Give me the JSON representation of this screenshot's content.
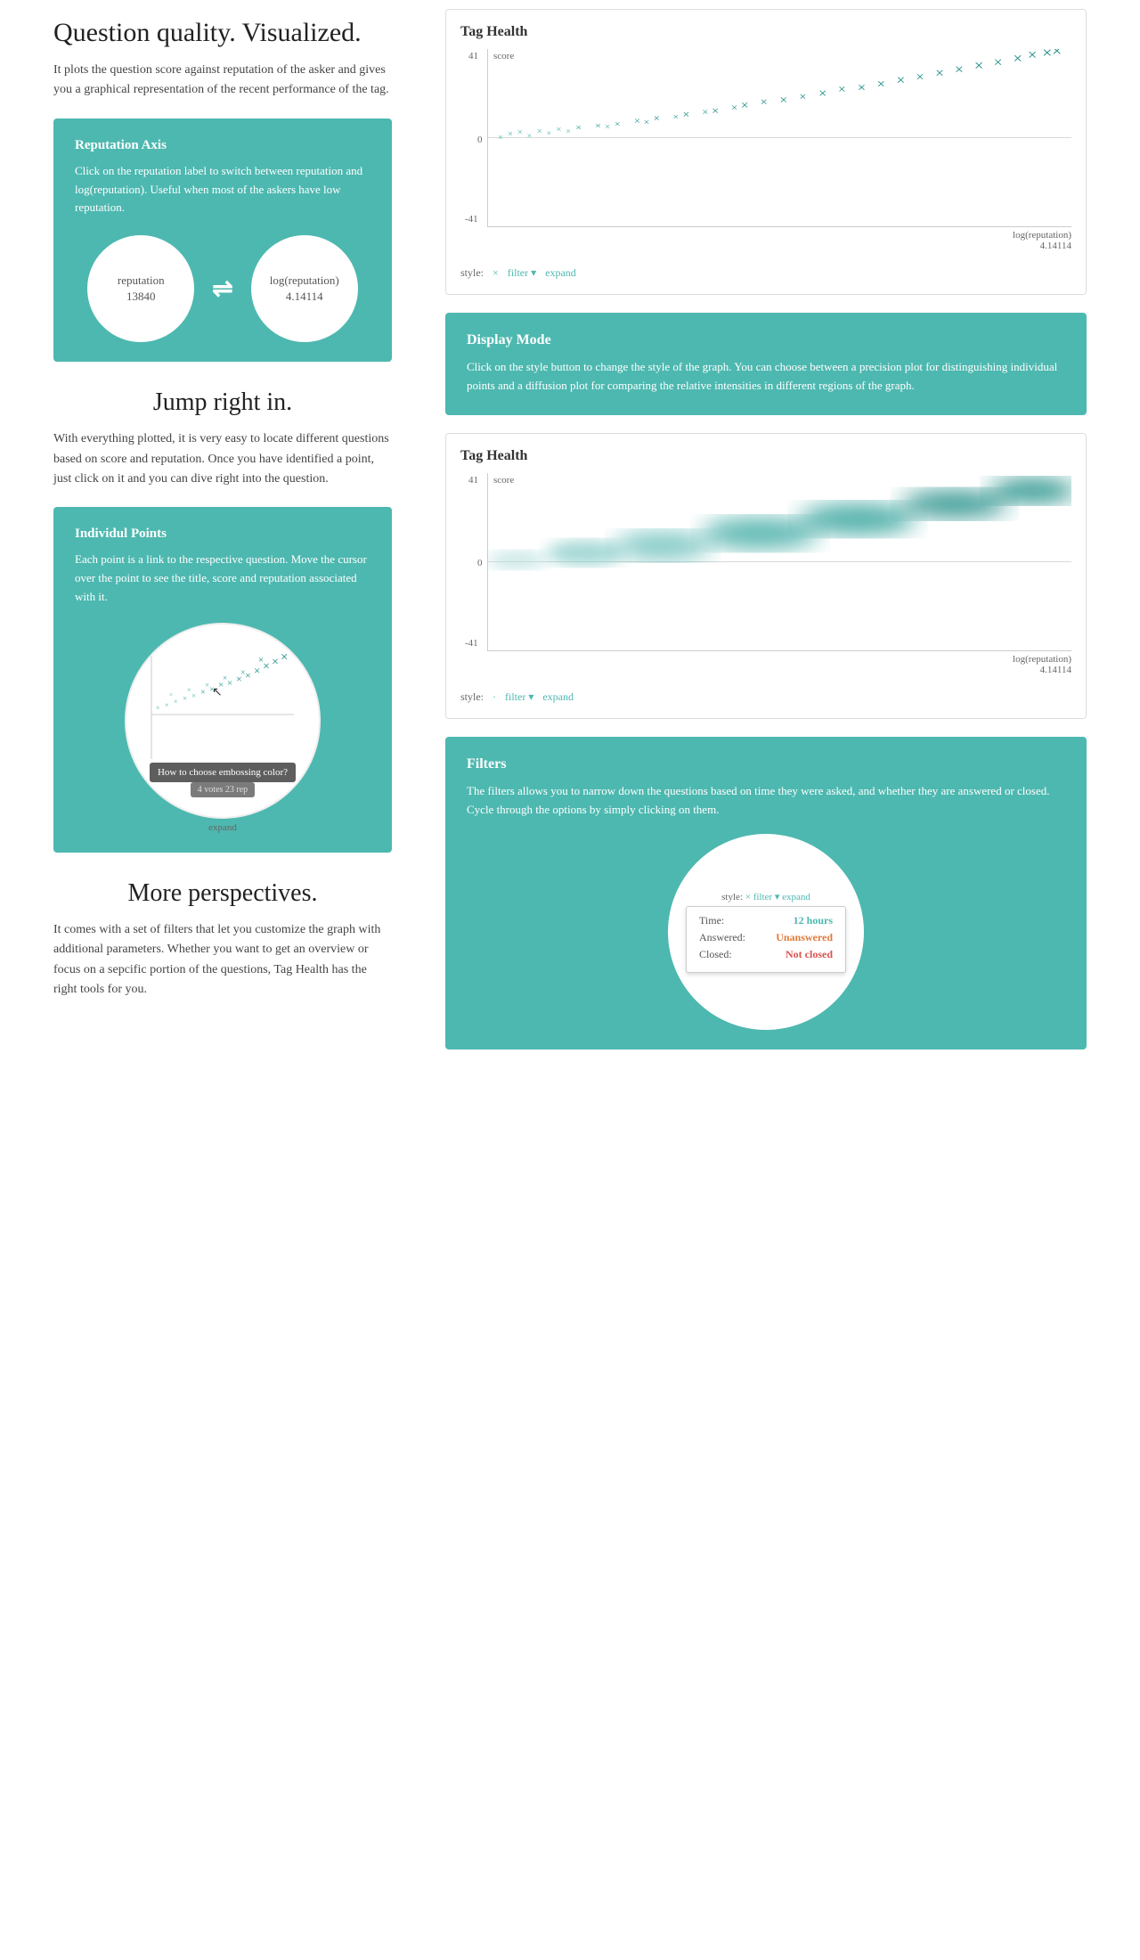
{
  "left": {
    "title1": "Question quality. Visualized.",
    "intro": "It plots the question score against reputation of the asker and gives you a graphical representation of the recent performance of the tag.",
    "repAxis": {
      "title": "Reputation Axis",
      "desc": "Click on the reputation label to switch between reputation and log(reputation). Useful when most of the askers have low reputation.",
      "circle1_line1": "reputation",
      "circle1_line2": "13840",
      "circle2_line1": "log(reputation)",
      "circle2_line2": "4.14114"
    },
    "title2": "Jump right in.",
    "jumpText": "With everything plotted, it is very easy to locate different questions based on score and reputation. Once you have identified a point, just click on it and you can dive right into the question.",
    "individualPoints": {
      "title": "Individul Points",
      "desc": "Each point is a link to the respective question. Move the cursor over the point to see the title, score and reputation associated with it."
    },
    "tooltipTitle": "How to choose embossing color?",
    "tooltipSub": "4 votes 23 rep",
    "expandLabel": "expand",
    "title3": "More perspectives.",
    "moreText": "It comes with a set of filters that let you customize the graph with additional parameters. Whether you want to get an overview or focus on a sepcific portion of the questions, Tag Health has the right tools for you."
  },
  "right": {
    "chart1": {
      "title": "Tag Health",
      "score41": "41",
      "scoreLabel": "score",
      "score0": "0",
      "scoreneg41": "-41",
      "repLabel": "log(reputation)",
      "repVal": "4.14114",
      "styleLabel": "style:",
      "styleVal": "×",
      "filterLabel": "filter",
      "expandLabel": "expand"
    },
    "displayMode": {
      "title": "Display Mode",
      "desc": "Click on the style button to change the style of the graph. You can choose between a precision plot for distinguishing individual points and a diffusion plot for comparing the relative intensities in different regions of the graph."
    },
    "chart2": {
      "title": "Tag Health",
      "score41": "41",
      "scoreLabel": "score",
      "score0": "0",
      "scoreneg41": "-41",
      "repLabel": "log(reputation)",
      "repVal": "4.14114",
      "styleLabel": "style:",
      "styleVal": "·",
      "filterLabel": "filter",
      "expandLabel": "expand"
    },
    "filters": {
      "title": "Filters",
      "desc": "The filters allows you to narrow down the questions based on time they were asked, and whether they are answered or closed. Cycle through the options by simply clicking on them.",
      "timeLabel": "Time:",
      "timeVal": "12 hours",
      "answeredLabel": "Answered:",
      "answeredVal": "Unanswered",
      "closedLabel": "Closed:",
      "closedVal": "Not closed",
      "miniStyleLabel": "style:",
      "miniStyleVal": "×",
      "miniFilterLabel": "filter",
      "miniExpandLabel": "expand"
    }
  }
}
